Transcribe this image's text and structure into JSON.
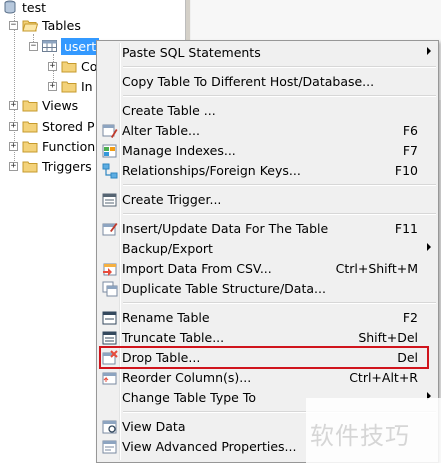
{
  "tree": {
    "db_label": "test",
    "tables_label": "Tables",
    "selected_table_label": "usert",
    "child1_label": "Co",
    "child2_label": "In",
    "views_label": "Views",
    "stored_label": "Stored P",
    "functions_label": "Function",
    "triggers_label": "Triggers"
  },
  "menu": {
    "items": [
      {
        "label": "Paste SQL Statements",
        "shortcut": "",
        "icon": "",
        "submenu": true
      },
      {
        "label": "Copy Table To Different Host/Database...",
        "shortcut": "",
        "icon": "",
        "submenu": false
      },
      {
        "label": "Create Table ...",
        "shortcut": "",
        "icon": "",
        "submenu": false
      },
      {
        "label": "Alter Table...",
        "shortcut": "F6",
        "icon": "alter-table-icon",
        "submenu": false
      },
      {
        "label": "Manage Indexes...",
        "shortcut": "F7",
        "icon": "manage-indexes-icon",
        "submenu": false
      },
      {
        "label": "Relationships/Foreign Keys...",
        "shortcut": "F10",
        "icon": "relationships-icon",
        "submenu": false
      },
      {
        "label": "Create Trigger...",
        "shortcut": "",
        "icon": "create-trigger-icon",
        "submenu": false
      },
      {
        "label": "Insert/Update Data For The Table",
        "shortcut": "F11",
        "icon": "insert-data-icon",
        "submenu": false
      },
      {
        "label": "Backup/Export",
        "shortcut": "",
        "icon": "",
        "submenu": true
      },
      {
        "label": "Import Data From CSV...",
        "shortcut": "Ctrl+Shift+M",
        "icon": "import-csv-icon",
        "submenu": false
      },
      {
        "label": "Duplicate Table Structure/Data...",
        "shortcut": "",
        "icon": "duplicate-table-icon",
        "submenu": false
      },
      {
        "label": "Rename Table",
        "shortcut": "F2",
        "icon": "rename-table-icon",
        "submenu": false
      },
      {
        "label": "Truncate Table...",
        "shortcut": "Shift+Del",
        "icon": "truncate-table-icon",
        "submenu": false
      },
      {
        "label": "Drop Table...",
        "shortcut": "Del",
        "icon": "drop-table-icon",
        "submenu": false
      },
      {
        "label": "Reorder Column(s)...",
        "shortcut": "Ctrl+Alt+R",
        "icon": "reorder-columns-icon",
        "submenu": false
      },
      {
        "label": "Change Table Type To",
        "shortcut": "",
        "icon": "",
        "submenu": true
      },
      {
        "label": "View Data",
        "shortcut": "",
        "icon": "view-data-icon",
        "submenu": false
      },
      {
        "label": "View Advanced Properties...",
        "shortcut": "",
        "icon": "view-properties-icon",
        "submenu": false
      }
    ]
  },
  "watermark": "软件技巧",
  "colors": {
    "selection": "#3399ff",
    "highlight_border": "#d0141c",
    "menu_bg": "#f0f0f0"
  }
}
